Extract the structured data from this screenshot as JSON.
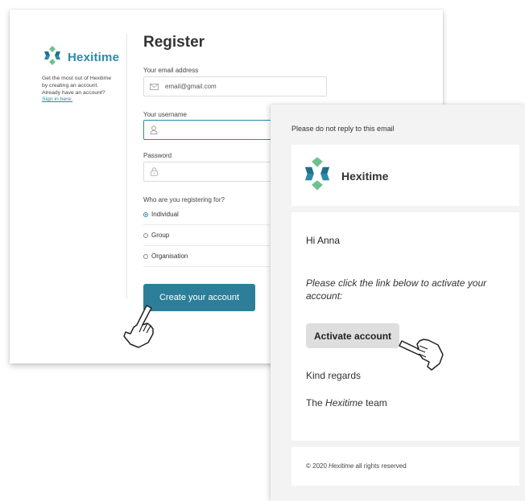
{
  "register": {
    "brand": "Hexitime",
    "side_note_prefix": "Get the most out of Hexitime by creating an account. Already have an account?",
    "sign_in_link": "Sign in here.",
    "title": "Register",
    "email_label": "Your email address",
    "email_value": "email@gmail.com",
    "username_label": "Your username",
    "password_label": "Password",
    "who_label": "Who are you registering for?",
    "options": [
      "Individual",
      "Group",
      "Organisation"
    ],
    "selected_option": "Individual",
    "create_button": "Create your account"
  },
  "email": {
    "noreply": "Please do not reply to this email",
    "brand": "Hexitime",
    "greeting": "Hi Anna",
    "instruction": "Please click the link below to activate your account:",
    "activate_button": "Activate account",
    "regards": "Kind regards",
    "team_prefix": "The",
    "team_brand": "Hexitime",
    "team_suffix": "team",
    "footer_prefix": "© 2020",
    "footer_brand": "Hexitime",
    "footer_suffix": "all rights reserved"
  },
  "colors": {
    "brand_teal": "#2b8aa8",
    "button_teal": "#2d7f99",
    "logo_dark": "#1f6f8c",
    "logo_green": "#6fc08f"
  },
  "icons": [
    "hexitime-logo-icon",
    "envelope-icon",
    "user-icon",
    "lock-icon",
    "pointing-hand-icon"
  ]
}
